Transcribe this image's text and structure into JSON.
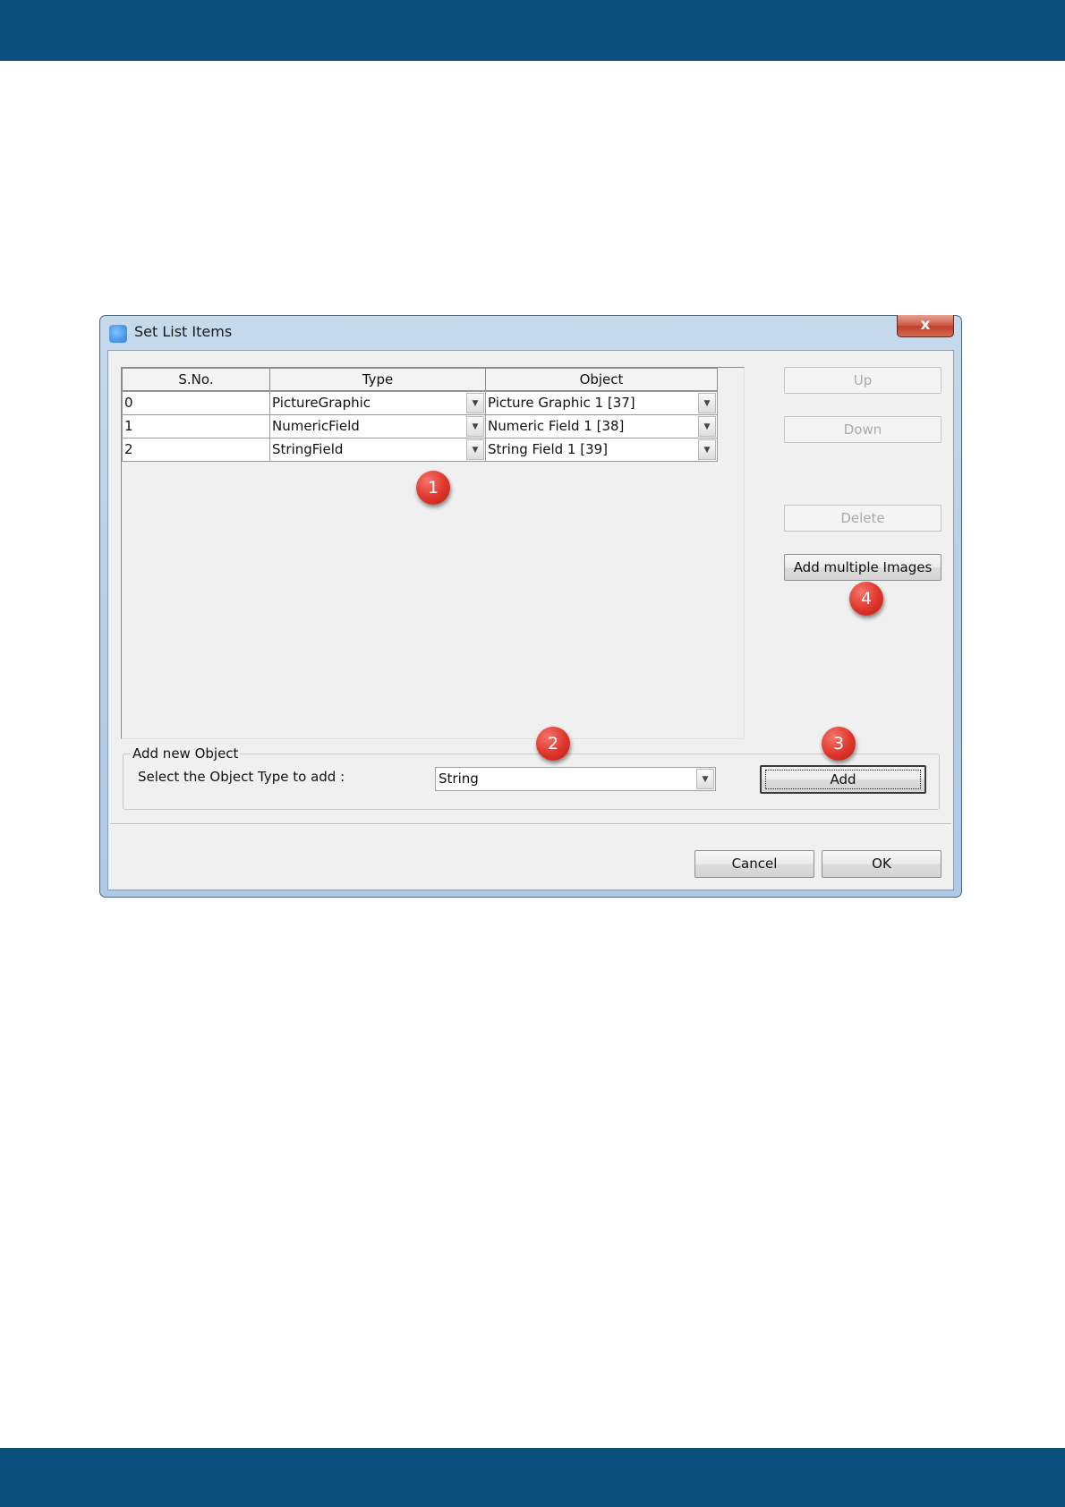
{
  "dialog": {
    "title": "Set List Items",
    "close_label": "x"
  },
  "table": {
    "headers": [
      "S.No.",
      "Type",
      "Object"
    ],
    "rows": [
      {
        "sno": "0",
        "type": "PictureGraphic",
        "object": "Picture Graphic 1 [37]"
      },
      {
        "sno": "1",
        "type": "NumericField",
        "object": "Numeric Field 1 [38]"
      },
      {
        "sno": "2",
        "type": "StringField",
        "object": "String Field 1 [39]"
      }
    ]
  },
  "side_buttons": {
    "up": "Up",
    "down": "Down",
    "delete": "Delete",
    "add_multiple": "Add multiple Images"
  },
  "add_group": {
    "legend": "Add new Object",
    "prompt": "Select the Object Type to add :",
    "selected_type": "String",
    "add_label": "Add"
  },
  "footer": {
    "cancel": "Cancel",
    "ok": "OK"
  },
  "callouts": [
    "1",
    "2",
    "3",
    "4"
  ],
  "colors": {
    "band": "#0a4f7c",
    "badge": "#e0342a",
    "dialog_frame": "#b9d1e8",
    "client_bg": "#f0f0f0"
  }
}
